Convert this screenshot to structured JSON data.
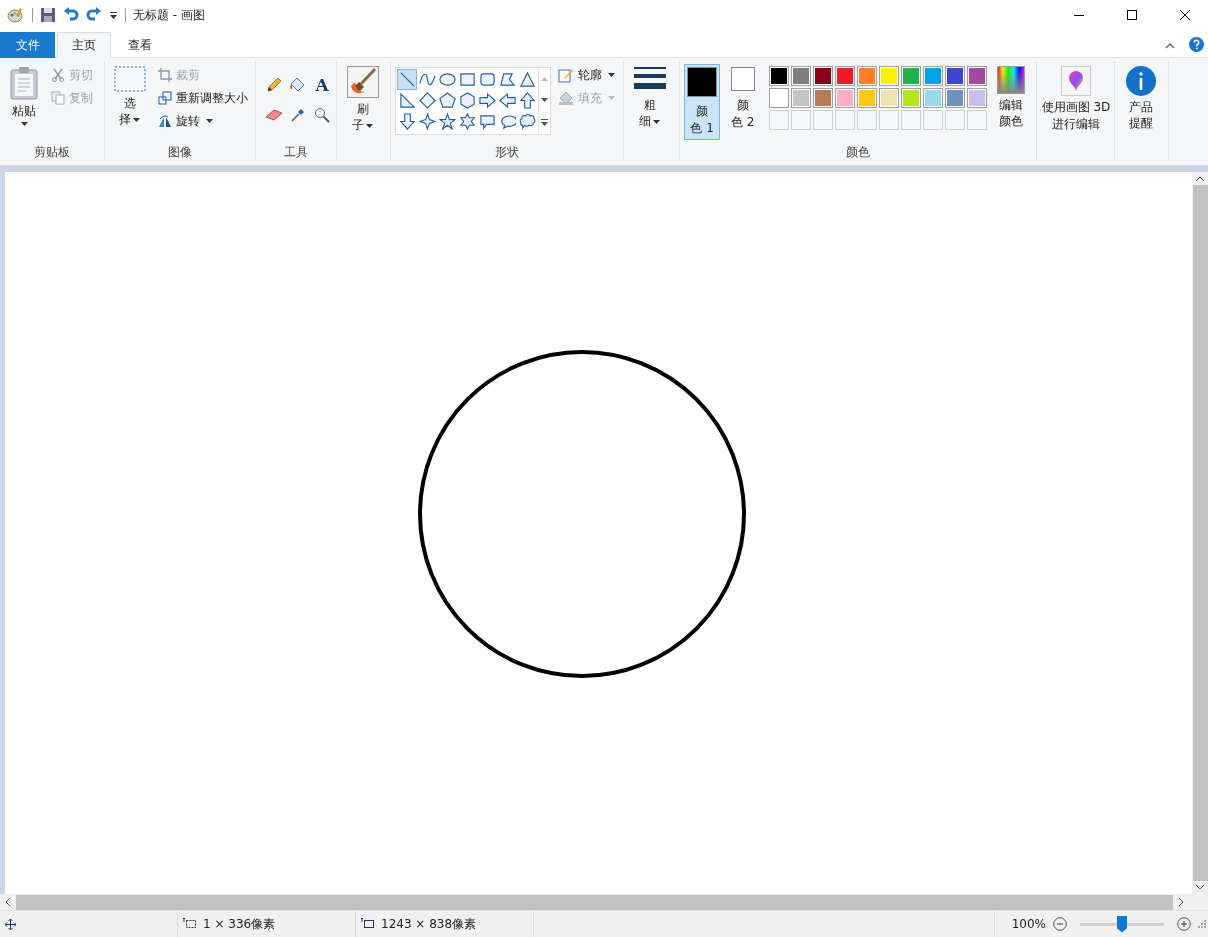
{
  "window": {
    "title": "无标题 - 画图"
  },
  "tabs": [
    {
      "label": "文件",
      "kind": "file",
      "selected": false
    },
    {
      "label": "主页",
      "kind": "tab",
      "selected": true
    },
    {
      "label": "查看",
      "kind": "tab",
      "selected": false
    }
  ],
  "clipboard": {
    "label": "剪贴板",
    "paste": "粘贴",
    "cut": {
      "label": "剪切",
      "disabled": true
    },
    "copy": {
      "label": "复制",
      "disabled": true
    }
  },
  "image": {
    "label": "图像",
    "select": "选择",
    "crop": {
      "label": "裁剪",
      "disabled": true
    },
    "resize": {
      "label": "重新调整大小",
      "disabled": false
    },
    "rotate": {
      "label": "旋转",
      "disabled": false
    }
  },
  "tools": {
    "label": "工具",
    "text_glyph": "A"
  },
  "brushes": {
    "label": "刷子"
  },
  "shapes": {
    "label": "形状",
    "items": [
      {
        "kind": "line",
        "selected": true
      },
      {
        "kind": "curve",
        "selected": false
      },
      {
        "kind": "oval",
        "selected": false
      },
      {
        "kind": "rect",
        "selected": false
      },
      {
        "kind": "roundrect",
        "selected": false
      },
      {
        "kind": "polygon",
        "selected": false
      },
      {
        "kind": "triangle",
        "selected": false
      },
      {
        "kind": "righttriangle",
        "selected": false
      },
      {
        "kind": "diamond",
        "selected": false
      },
      {
        "kind": "pentagon",
        "selected": false
      },
      {
        "kind": "hexagon",
        "selected": false
      },
      {
        "kind": "arrowright",
        "selected": false
      },
      {
        "kind": "arrowleft",
        "selected": false
      },
      {
        "kind": "arrowup",
        "selected": false
      },
      {
        "kind": "arrowdown",
        "selected": false
      },
      {
        "kind": "star4",
        "selected": false
      },
      {
        "kind": "star5",
        "selected": false
      },
      {
        "kind": "star6",
        "selected": false
      },
      {
        "kind": "calloutrect",
        "selected": false
      },
      {
        "kind": "calloutoval",
        "selected": false
      },
      {
        "kind": "calloutcloud",
        "selected": false
      }
    ],
    "outline": {
      "label": "轮廓",
      "disabled": false
    },
    "fill": {
      "label": "填充",
      "disabled": true
    }
  },
  "size": {
    "label": "粗细"
  },
  "colors": {
    "label": "颜色",
    "slots": [
      {
        "label": "颜色 1",
        "color": "#000000",
        "selected": true
      },
      {
        "label": "颜色 2",
        "color": "#ffffff",
        "selected": false
      }
    ],
    "palette": [
      {
        "color": "#000000"
      },
      {
        "color": "#7f7f7f"
      },
      {
        "color": "#880015"
      },
      {
        "color": "#ed1c24"
      },
      {
        "color": "#ff7f27"
      },
      {
        "color": "#fff200"
      },
      {
        "color": "#22b14c"
      },
      {
        "color": "#00a2e8"
      },
      {
        "color": "#3f48cc"
      },
      {
        "color": "#a349a4"
      },
      {
        "color": "#ffffff"
      },
      {
        "color": "#c3c3c3"
      },
      {
        "color": "#b97a57"
      },
      {
        "color": "#ffaec9"
      },
      {
        "color": "#ffc90e"
      },
      {
        "color": "#efe4b0"
      },
      {
        "color": "#b5e61d"
      },
      {
        "color": "#99d9ea"
      },
      {
        "color": "#7092be"
      },
      {
        "color": "#c8bfe7"
      }
    ],
    "edit": "编辑颜色"
  },
  "paint3d": {
    "label": "使用画图 3D 进行编辑"
  },
  "alert": {
    "label": "产品提醒"
  },
  "status_bar": {
    "selection": "1 × 336像素",
    "canvas_size": "1243 × 838像素",
    "zoom": "100%",
    "zoom_level": {
      "level": 0.5
    }
  }
}
